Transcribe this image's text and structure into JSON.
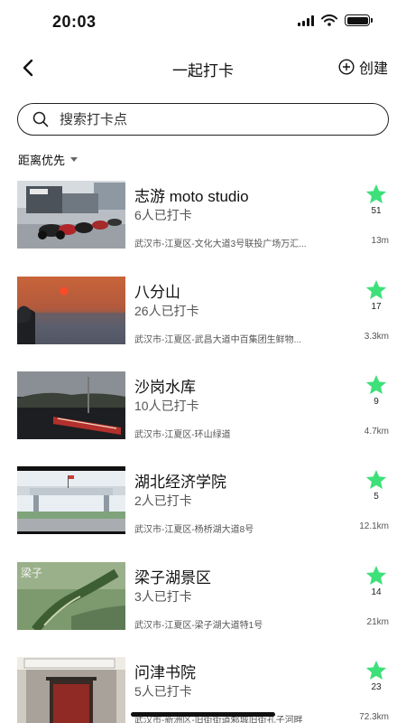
{
  "status_bar": {
    "time": "20:03"
  },
  "nav": {
    "title": "一起打卡",
    "create_label": "创建"
  },
  "search": {
    "placeholder": "搜索打卡点"
  },
  "sort": {
    "label": "距离优先"
  },
  "colors": {
    "star": "#3ee07a",
    "text": "#111111",
    "muted": "#555555"
  },
  "items": [
    {
      "name": "志游 moto studio",
      "checkins": "6人已打卡",
      "address": "武汉市-江夏区-文化大道3号联投广场万汇...",
      "distance": "13m",
      "stars": "51"
    },
    {
      "name": "八分山",
      "checkins": "26人已打卡",
      "address": "武汉市-江夏区-武昌大道中百集团生鲜物...",
      "distance": "3.3km",
      "stars": "17"
    },
    {
      "name": "沙岗水库",
      "checkins": "10人已打卡",
      "address": "武汉市-江夏区-环山绿道",
      "distance": "4.7km",
      "stars": "9"
    },
    {
      "name": "湖北经济学院",
      "checkins": "2人已打卡",
      "address": "武汉市-江夏区-杨桥湖大道8号",
      "distance": "12.1km",
      "stars": "5"
    },
    {
      "name": "梁子湖景区",
      "checkins": "3人已打卡",
      "address": "武汉市-江夏区-梁子湖大道特1号",
      "distance": "21km",
      "stars": "14"
    },
    {
      "name": "问津书院",
      "checkins": "5人已打卡",
      "address": "武汉市-新洲区-旧街街道邾城旧街孔子河畔",
      "distance": "72.3km",
      "stars": "23"
    }
  ]
}
